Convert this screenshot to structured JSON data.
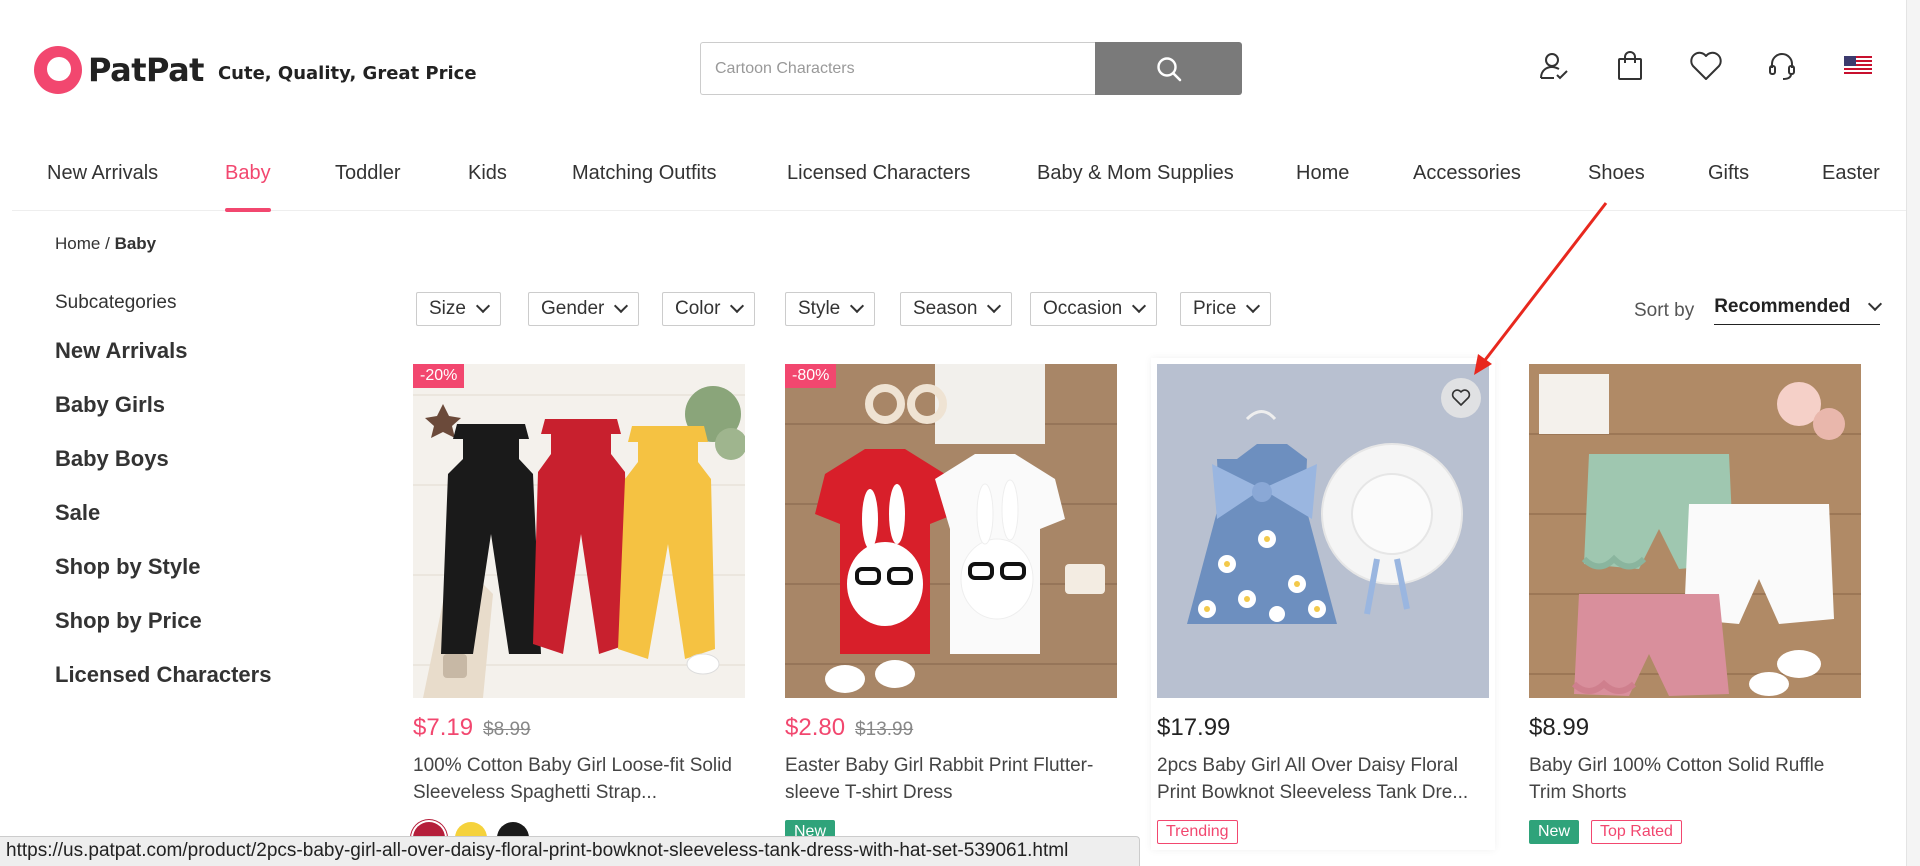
{
  "brand": {
    "name": "PatPat",
    "tagline": "Cute, Quality, Great Price",
    "color": "#f2476f"
  },
  "search": {
    "placeholder": "Cartoon Characters"
  },
  "header_icons": [
    "account-icon",
    "shopping-bag-icon",
    "wishlist-heart-icon",
    "customer-service-icon",
    "us-flag-icon"
  ],
  "nav": {
    "items": [
      {
        "label": "New Arrivals"
      },
      {
        "label": "Baby",
        "active": true
      },
      {
        "label": "Toddler"
      },
      {
        "label": "Kids"
      },
      {
        "label": "Matching Outfits"
      },
      {
        "label": "Licensed Characters"
      },
      {
        "label": "Baby & Mom Supplies"
      },
      {
        "label": "Home"
      },
      {
        "label": "Accessories"
      },
      {
        "label": "Shoes"
      },
      {
        "label": "Gifts"
      },
      {
        "label": "Easter"
      }
    ]
  },
  "breadcrumb": {
    "home": "Home",
    "separator": "/",
    "current": "Baby"
  },
  "sidebar": {
    "title": "Subcategories",
    "items": [
      "New Arrivals",
      "Baby Girls",
      "Baby Boys",
      "Sale",
      "Shop by Style",
      "Shop by Price",
      "Licensed Characters"
    ]
  },
  "filters": [
    "Size",
    "Gender",
    "Color",
    "Style",
    "Season",
    "Occasion",
    "Price"
  ],
  "sort": {
    "label": "Sort by",
    "value": "Recommended"
  },
  "products": [
    {
      "discount": "-20%",
      "price": "$7.19",
      "original_price": "$8.99",
      "title": "100% Cotton Baby Girl Loose-fit Solid Sleeveless Spaghetti Strap...",
      "swatches": [
        "#b51e3a",
        "#f5d23c",
        "#1a1a1a"
      ],
      "tags": []
    },
    {
      "discount": "-80%",
      "price": "$2.80",
      "original_price": "$13.99",
      "title": "Easter Baby Girl Rabbit Print Flutter-sleeve T-shirt Dress",
      "swatches": [],
      "tags": [
        {
          "label": "New",
          "kind": "new"
        }
      ]
    },
    {
      "discount": "",
      "price": "$17.99",
      "original_price": "",
      "title": "2pcs Baby Girl All Over Daisy Floral Print Bowknot Sleeveless Tank Dre...",
      "swatches": [],
      "tags": [
        {
          "label": "Trending",
          "kind": "outline"
        }
      ]
    },
    {
      "discount": "",
      "price": "$8.99",
      "original_price": "",
      "title": "Baby Girl 100% Cotton Solid Ruffle Trim Shorts",
      "swatches": [],
      "tags": [
        {
          "label": "New",
          "kind": "new"
        },
        {
          "label": "Top Rated",
          "kind": "outline"
        }
      ]
    }
  ],
  "status_bar": {
    "url": "https://us.patpat.com/product/2pcs-baby-girl-all-over-daisy-floral-print-bowknot-sleeveless-tank-dress-with-hat-set-539061.html"
  },
  "colors": {
    "accent": "#f2476f",
    "tag_new": "#2fa37a",
    "arrow": "#e8281e"
  }
}
